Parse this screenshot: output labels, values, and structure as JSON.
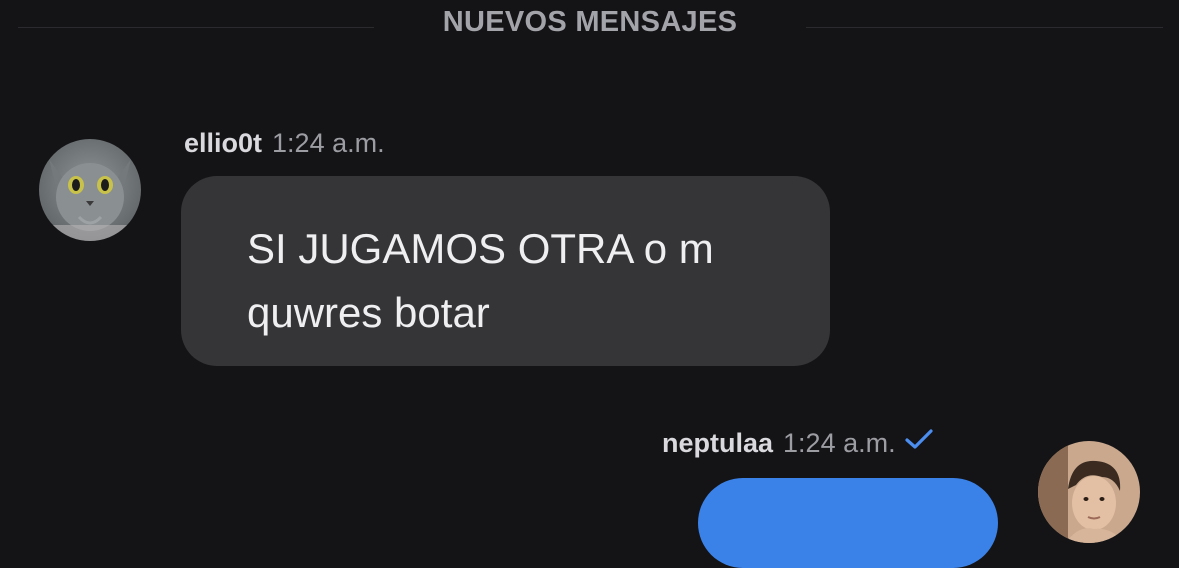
{
  "divider": {
    "label": "NUEVOS MENSAJES"
  },
  "messages": [
    {
      "username": "ellio0t",
      "time": "1:24 a.m.",
      "text": "SI JUGAMOS OTRA o m quwres botar",
      "avatar": "gray-cat-avatar",
      "direction": "incoming",
      "bubble_color": "#353537"
    },
    {
      "username": "neptulaa",
      "time": "1:24 a.m.",
      "status_icon": "check-icon",
      "avatar": "user-photo-avatar",
      "direction": "outgoing",
      "bubble_color": "#3b82e8"
    }
  ],
  "colors": {
    "background": "#141416",
    "accent": "#3b82e8",
    "check": "#4b8ef0"
  }
}
